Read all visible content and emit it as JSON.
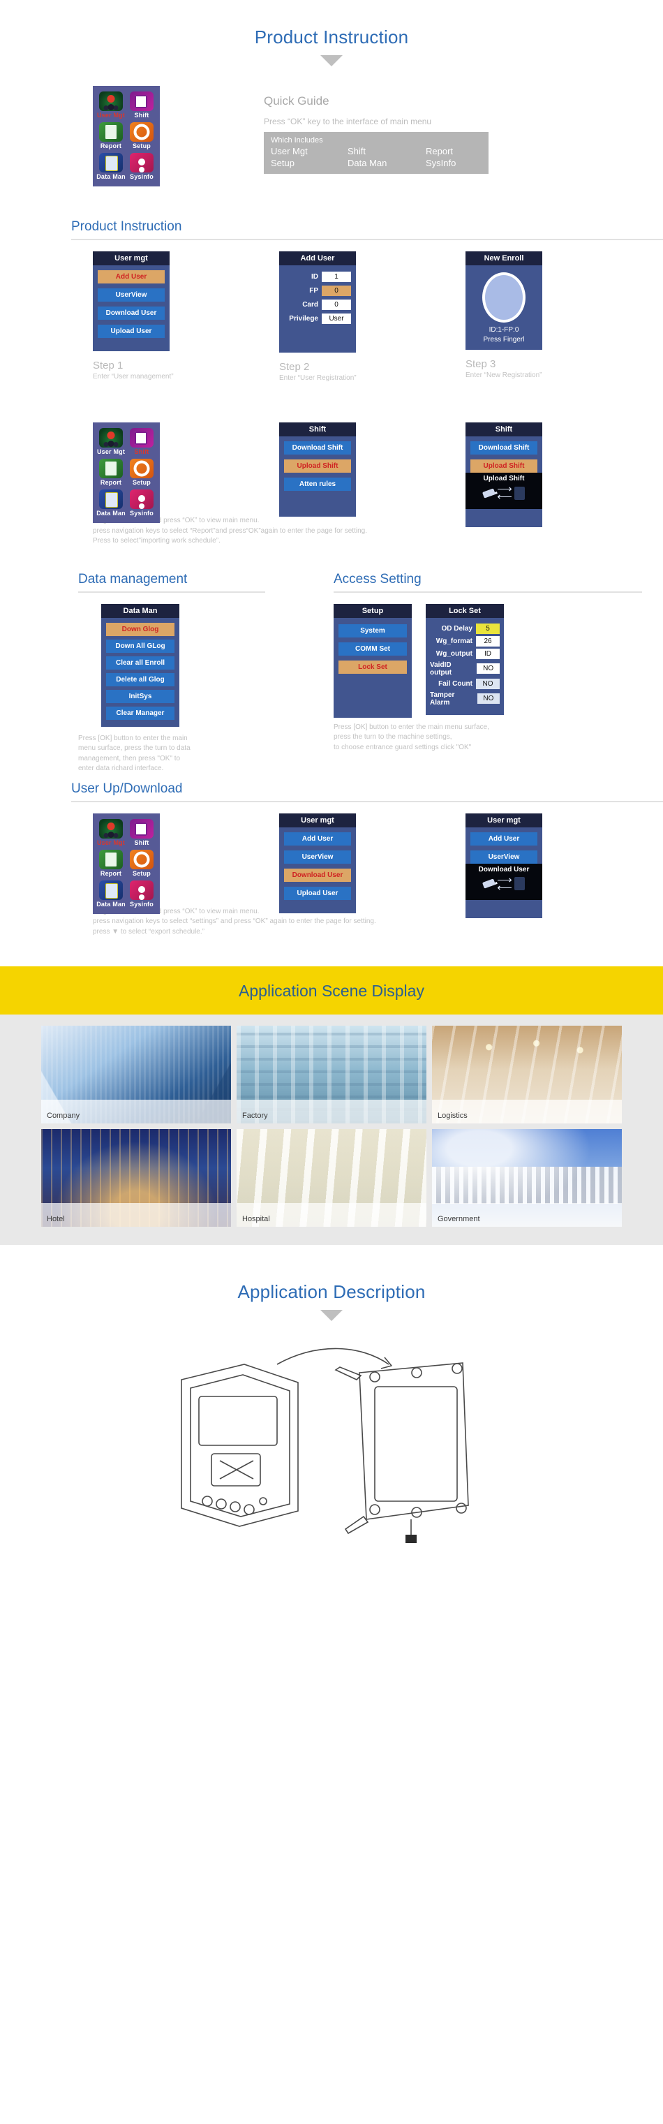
{
  "sections": {
    "product_instruction_top": {
      "heading": "Product Instruction"
    },
    "quick_guide": {
      "title": "Quick Guide",
      "subtitle": "Press “OK” key to the interface of main menu",
      "box_lead": "Which Includes",
      "items": [
        "User Mgt",
        "Shift",
        "Report",
        "Setup",
        "Data Man",
        "SysInfo"
      ]
    },
    "product_instruction": {
      "title": "Product Instruction",
      "note": "Plug in flash drive and press “OK” to view main menu.\npress navigation keys to select “Report”and press“OK”again to enter the page for setting.\nPress to select”importing work schedule”."
    },
    "data_management": {
      "title": "Data management",
      "note": "Press [OK] button to enter the main\nmenu surface, press the turn to data\nmanagement, then press \"OK\" to\nenter data richard interface."
    },
    "access_setting": {
      "title": "Access Setting",
      "note": "Press [OK] button to enter the main menu surface,\npress the turn to the machine settings,\nto choose entrance guard settings click \"OK\""
    },
    "user_up_download": {
      "title": "User Up/Download",
      "note": "Plug in flash drive and press “OK” to view main menu.\npress navigation keys to select “settings” and press “OK” again to enter the page for setting.\npress ▼ to select “export schedule.”"
    },
    "application_scene": {
      "heading": "Application Scene Display"
    },
    "application_description": {
      "heading": "Application Description"
    }
  },
  "device_menu": {
    "cells": [
      {
        "label": "User Mgt",
        "icon": "user-icon",
        "selected": true
      },
      {
        "label": "Shift",
        "icon": "shift-icon",
        "selected": false
      },
      {
        "label": "Report",
        "icon": "report-icon",
        "selected": false
      },
      {
        "label": "Setup",
        "icon": "setup-icon",
        "selected": false
      },
      {
        "label": "Data Man",
        "icon": "data-man-icon",
        "selected": false
      },
      {
        "label": "Sysinfo",
        "icon": "sysinfo-icon",
        "selected": false
      }
    ]
  },
  "screens": {
    "user_mgt_step1": {
      "title": "User mgt",
      "buttons": [
        {
          "label": "Add User",
          "highlight": true
        },
        {
          "label": "UserView",
          "highlight": false
        },
        {
          "label": "Download User",
          "highlight": false
        },
        {
          "label": "Upload User",
          "highlight": false
        }
      ]
    },
    "add_user_step2": {
      "title": "Add User",
      "rows": [
        {
          "label": "ID",
          "value": "1",
          "style": "white"
        },
        {
          "label": "FP",
          "value": "0",
          "style": "orange"
        },
        {
          "label": "Card",
          "value": "0",
          "style": "white"
        },
        {
          "label": "Privilege",
          "value": "User",
          "style": "white"
        }
      ]
    },
    "new_enroll_step3": {
      "title": "New Enroll",
      "line1": "ID:1-FP:0",
      "line2": "Press Fingerl"
    },
    "shift_menu": {
      "title": "Shift",
      "buttons": [
        {
          "label": "Download Shift",
          "highlight": false
        },
        {
          "label": "Upload Shift",
          "highlight": true
        },
        {
          "label": "Atten rules",
          "highlight": false
        }
      ]
    },
    "shift_transfer": {
      "title": "Shift",
      "buttons": [
        {
          "label": "Download Shift",
          "highlight": false
        },
        {
          "label": "Upload Shift",
          "highlight": true
        }
      ],
      "overlay_caption": "Upload Shift"
    },
    "data_man": {
      "title": "Data Man",
      "buttons": [
        {
          "label": "Down Glog",
          "highlight": true
        },
        {
          "label": "Down All GLog",
          "highlight": false
        },
        {
          "label": "Clear all Enroll",
          "highlight": false
        },
        {
          "label": "Delete all Glog",
          "highlight": false
        },
        {
          "label": "InitSys",
          "highlight": false
        },
        {
          "label": "Clear Manager",
          "highlight": false
        }
      ]
    },
    "setup": {
      "title": "Setup",
      "buttons": [
        {
          "label": "System",
          "highlight": false
        },
        {
          "label": "COMM Set",
          "highlight": false
        },
        {
          "label": "Lock Set",
          "highlight": true
        }
      ]
    },
    "lock_set": {
      "title": "Lock Set",
      "rows": [
        {
          "label": "OD Delay",
          "value": "5",
          "style": "yellow"
        },
        {
          "label": "Wg_format",
          "value": "26",
          "style": "white"
        },
        {
          "label": "Wg_output",
          "value": "ID",
          "style": "white"
        },
        {
          "label": "VaidID output",
          "value": "NO",
          "style": "white"
        },
        {
          "label": "Fail Count",
          "value": "NO",
          "style": "pale"
        },
        {
          "label": "Tamper Alarm",
          "value": "NO",
          "style": "pale"
        }
      ]
    },
    "user_mgt_plain": {
      "title": "User mgt",
      "buttons": [
        {
          "label": "Add User",
          "highlight": false
        },
        {
          "label": "UserView",
          "highlight": false
        },
        {
          "label": "Download User",
          "highlight": true
        },
        {
          "label": "Upload User",
          "highlight": false
        }
      ]
    },
    "user_mgt_transfer": {
      "title": "User mgt",
      "buttons": [
        {
          "label": "Add User",
          "highlight": false
        },
        {
          "label": "UserView",
          "highlight": false
        }
      ],
      "overlay_caption": "Download User"
    }
  },
  "steps": [
    {
      "heading": "Step 1",
      "caption": "Enter “User management”"
    },
    {
      "heading": "Step 2",
      "caption": "Enter “User Registration”"
    },
    {
      "heading": "Step 3",
      "caption": "Enter “New Registration”"
    }
  ],
  "scenes": [
    {
      "label": "Company",
      "css": "sc-company"
    },
    {
      "label": "Factory",
      "css": "sc-factory"
    },
    {
      "label": "Logistics",
      "css": "sc-logistics"
    },
    {
      "label": "Hotel",
      "css": "sc-hotel"
    },
    {
      "label": "Hospital",
      "css": "sc-hospital"
    },
    {
      "label": "Government",
      "css": "sc-government"
    }
  ],
  "colors": {
    "accent_blue": "#2e6cb5",
    "screen_bg": "#41558f",
    "screen_title_bg": "#1d2340",
    "button_blue": "#2a72c4",
    "highlight_orange": "#dca666",
    "highlight_text_red": "#cf2323",
    "band_yellow": "#f5d400",
    "device_menu_bg": "#565a96"
  }
}
